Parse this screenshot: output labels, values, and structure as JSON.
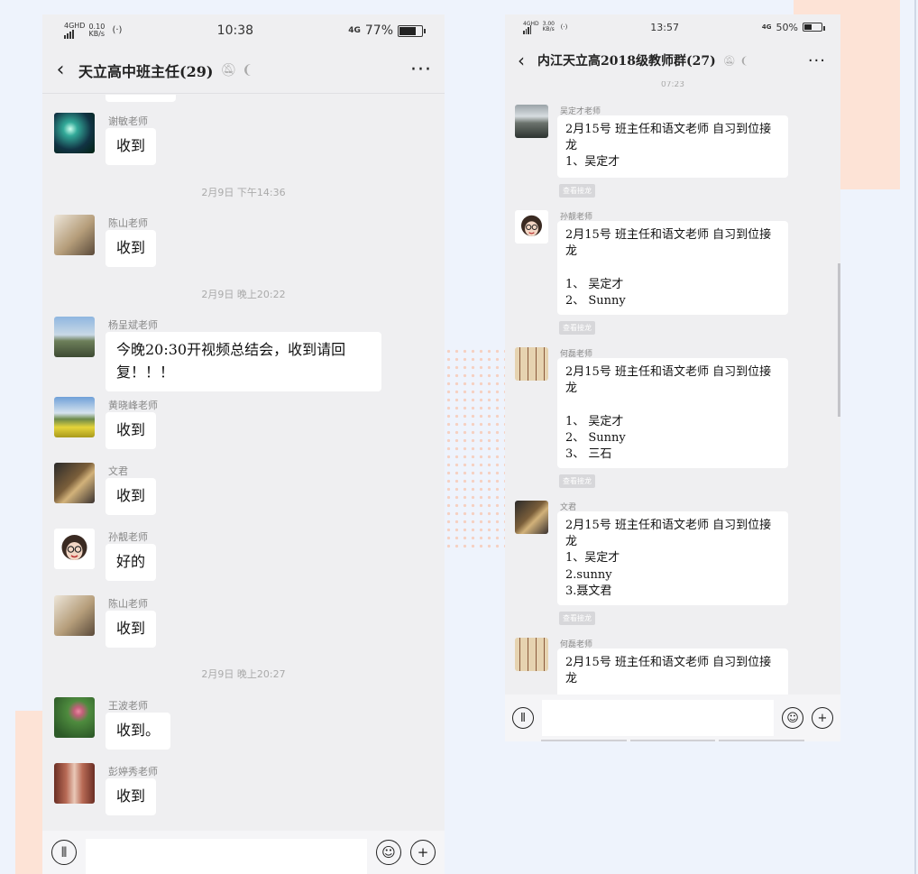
{
  "left": {
    "status": {
      "net_small": "4GHD",
      "speed": "0.10 KB/s",
      "time": "10:38",
      "net_type": "4G",
      "battery": "77%",
      "battery_fill": 0.77
    },
    "chat_title": "天立高中班主任(29)",
    "messages": [
      {
        "sender": "谢敏老师",
        "text": "收到",
        "avatar": "avatar-dandelion"
      },
      {
        "timestamp": "2月9日 下午14:36"
      },
      {
        "sender": "陈山老师",
        "text": "收到",
        "avatar": "avatar-child"
      },
      {
        "timestamp": "2月9日 晚上20:22"
      },
      {
        "sender": "杨呈斌老师",
        "text": "今晚20:30开视频总结会，收到请回复！！！",
        "avatar": "avatar-city"
      },
      {
        "sender": "黄晓峰老师",
        "text": "收到",
        "avatar": "avatar-flowers"
      },
      {
        "sender": "文君",
        "text": "收到",
        "avatar": "avatar-kid"
      },
      {
        "sender": "孙靓老师",
        "text": "好的",
        "avatar": "avatar-cartoon-girl"
      },
      {
        "sender": "陈山老师",
        "text": "收到",
        "avatar": "avatar-child"
      },
      {
        "timestamp": "2月9日 晚上20:27"
      },
      {
        "sender": "王波老师",
        "text": "收到。",
        "avatar": "avatar-lotus"
      },
      {
        "sender": "彭婷秀老师",
        "text": "收到",
        "avatar": "avatar-seal"
      }
    ]
  },
  "right": {
    "status": {
      "net_small": "4GHD",
      "speed": "3.00 KB/s",
      "time": "13:57",
      "net_type": "4G",
      "battery": "50%",
      "battery_fill": 0.5
    },
    "chat_title": "内江天立高2018级教师群(27)",
    "top_time": "07:23",
    "view_relay": "查看接龙",
    "messages": [
      {
        "sender": "吴定才老师",
        "text": "2月15号 班主任和语文老师 自习到位接龙\n1、吴定才",
        "avatar": "avatar-lake"
      },
      {
        "sender": "孙靓老师",
        "text": "2月15号 班主任和语文老师 自习到位接龙\n\n1、 吴定才\n2、 Sunny",
        "avatar": "avatar-cartoon-girl"
      },
      {
        "sender": "何磊老师",
        "text": "2月15号 班主任和语文老师 自习到位接龙\n\n1、 吴定才\n2、 Sunny\n3、 三石",
        "avatar": "avatar-calligraphy"
      },
      {
        "sender": "文君",
        "text": "2月15号 班主任和语文老师 自习到位接龙\n1、吴定才\n2.sunny\n3.聂文君",
        "avatar": "avatar-kid"
      },
      {
        "sender": "何磊老师",
        "text": "2月15号 班主任和语文老师 自习到位接龙",
        "avatar": "avatar-calligraphy"
      }
    ]
  },
  "icons": [
    "back-icon",
    "mute-icon",
    "ear-icon",
    "more-icon",
    "voice-icon",
    "emoji-icon",
    "plus-icon"
  ],
  "colors": {
    "chat_bg": "#efeff1",
    "bubble": "#ffffff",
    "page_bg": "#eef3fc",
    "accent_peach": "#fde3d6"
  }
}
